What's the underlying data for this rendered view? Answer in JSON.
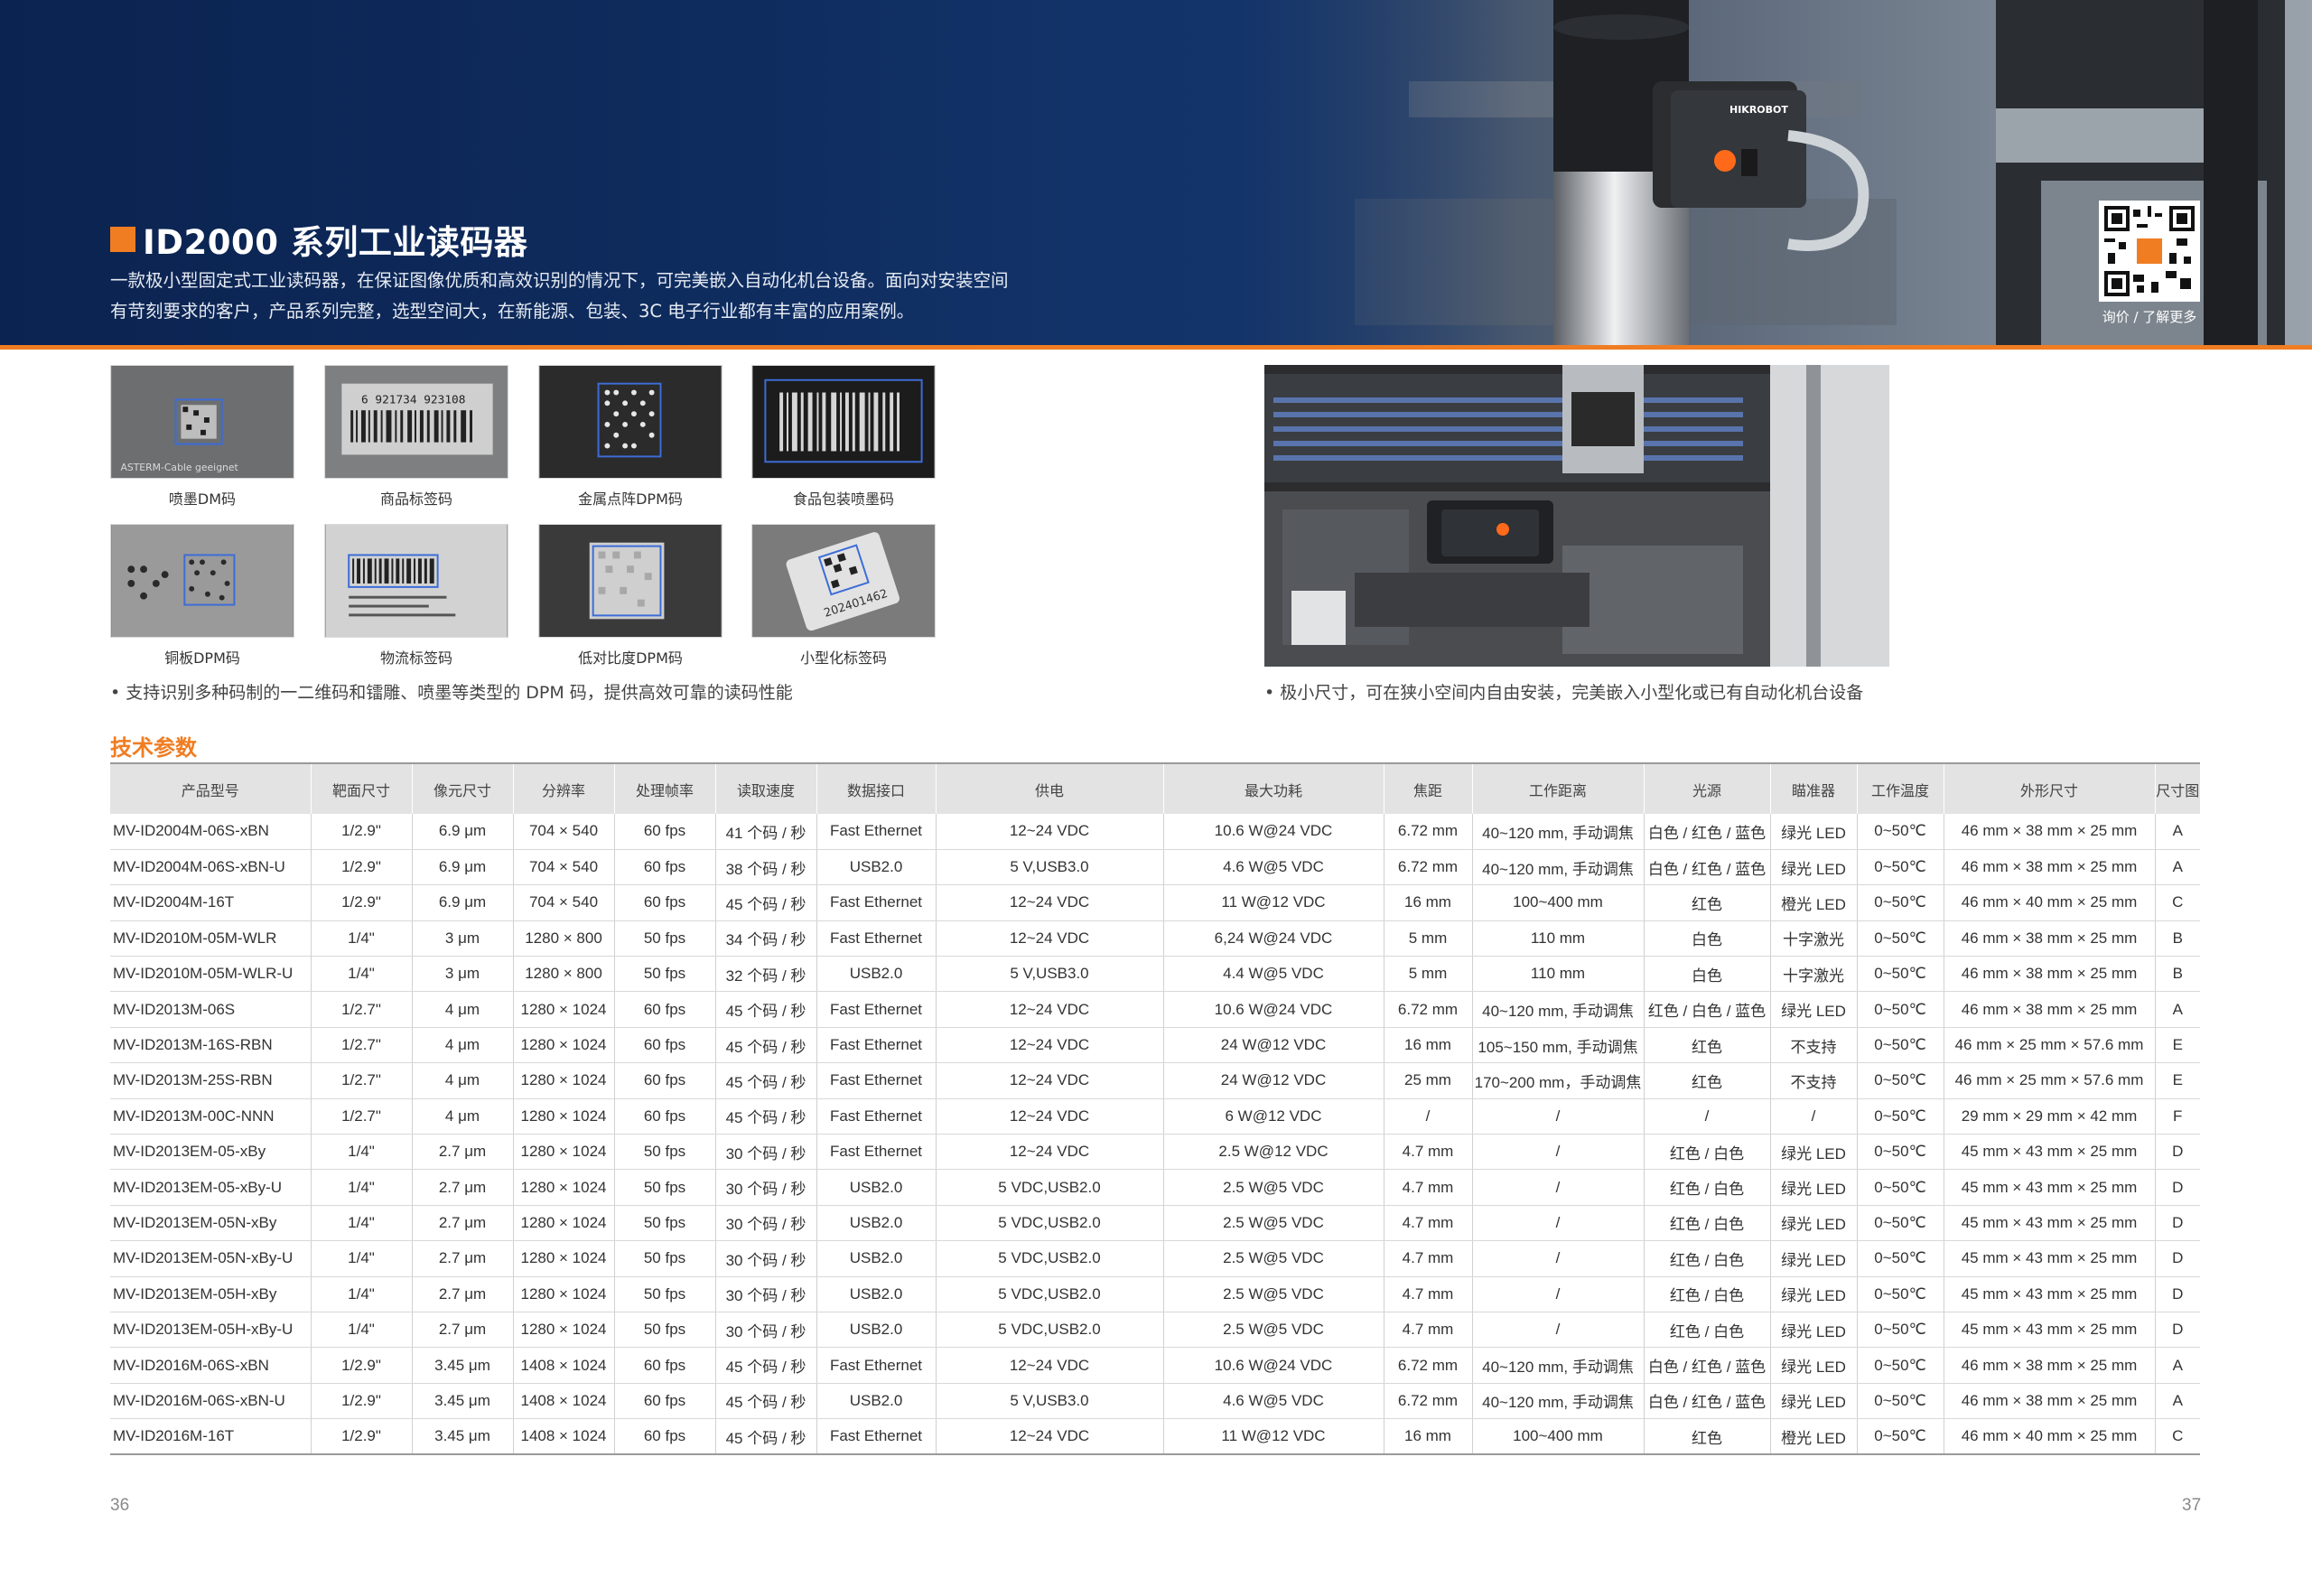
{
  "hero": {
    "title": "ID2000 系列工业读码器",
    "intro_line1": "一款极小型固定式工业读码器，在保证图像优质和高效识别的情况下，可完美嵌入自动化机台设备。面向对安装空间",
    "intro_line2": "有苛刻要求的客户，产品系列完整，选型空间大，在新能源、包装、3C 电子行业都有丰富的应用案例。",
    "qr_caption": "询价 / 了解更多",
    "camera_brand": "HIKROBOT",
    "accent_color": "#f07d22",
    "banner_color": "#0f2d60"
  },
  "samples": [
    {
      "caption": "喷墨DM码"
    },
    {
      "caption": "商品标签码"
    },
    {
      "caption": "金属点阵DPM码"
    },
    {
      "caption": "食品包装喷墨码"
    },
    {
      "caption": "铜板DPM码"
    },
    {
      "caption": "物流标签码"
    },
    {
      "caption": "低对比度DPM码"
    },
    {
      "caption": "小型化标签码"
    }
  ],
  "bullets": {
    "left": "•  支持识别多种码制的一二维码和镭雕、喷墨等类型的 DPM 码，提供高效可靠的读码性能",
    "right": "•  极小尺寸，可在狭小空间内自由安装，完美嵌入小型化或已有自动化机台设备"
  },
  "specs": {
    "section_title": "技术参数",
    "headers": [
      "产品型号",
      "靶面尺寸",
      "像元尺寸",
      "分辨率",
      "处理帧率",
      "读取速度",
      "数据接口",
      "供电",
      "最大功耗",
      "焦距",
      "工作距离",
      "光源",
      "瞄准器",
      "工作温度",
      "外形尺寸",
      "尺寸图"
    ],
    "rows": [
      [
        "MV-ID2004M-06S-xBN",
        "1/2.9\"",
        "6.9 μm",
        "704 × 540",
        "60 fps",
        "41 个码 / 秒",
        "Fast Ethernet",
        "12~24 VDC",
        "10.6 W@24 VDC",
        "6.72 mm",
        "40~120 mm, 手动调焦",
        "白色 / 红色 / 蓝色",
        "绿光 LED",
        "0~50℃",
        "46 mm × 38 mm × 25 mm",
        "A"
      ],
      [
        "MV-ID2004M-06S-xBN-U",
        "1/2.9\"",
        "6.9 μm",
        "704 × 540",
        "60 fps",
        "38 个码 / 秒",
        "USB2.0",
        "5 V,USB3.0",
        "4.6 W@5 VDC",
        "6.72 mm",
        "40~120 mm, 手动调焦",
        "白色 / 红色 / 蓝色",
        "绿光 LED",
        "0~50℃",
        "46 mm × 38 mm × 25 mm",
        "A"
      ],
      [
        "MV-ID2004M-16T",
        "1/2.9\"",
        "6.9 μm",
        "704 × 540",
        "60 fps",
        "45 个码 / 秒",
        "Fast Ethernet",
        "12~24 VDC",
        "11 W@12 VDC",
        "16 mm",
        "100~400 mm",
        "红色",
        "橙光 LED",
        "0~50℃",
        "46 mm × 40 mm × 25 mm",
        "C"
      ],
      [
        "MV-ID2010M-05M-WLR",
        "1/4\"",
        "3 μm",
        "1280 × 800",
        "50 fps",
        "34 个码 / 秒",
        "Fast Ethernet",
        "12~24 VDC",
        "6,24 W@24 VDC",
        "5 mm",
        "110 mm",
        "白色",
        "十字激光",
        "0~50℃",
        "46 mm × 38 mm × 25 mm",
        "B"
      ],
      [
        "MV-ID2010M-05M-WLR-U",
        "1/4\"",
        "3 μm",
        "1280 × 800",
        "50 fps",
        "32 个码 / 秒",
        "USB2.0",
        "5 V,USB3.0",
        "4.4 W@5 VDC",
        "5 mm",
        "110 mm",
        "白色",
        "十字激光",
        "0~50℃",
        "46 mm × 38 mm × 25 mm",
        "B"
      ],
      [
        "MV-ID2013M-06S",
        "1/2.7\"",
        "4 μm",
        "1280 × 1024",
        "60 fps",
        "45 个码 / 秒",
        "Fast Ethernet",
        "12~24 VDC",
        "10.6 W@24 VDC",
        "6.72 mm",
        "40~120 mm, 手动调焦",
        "红色 / 白色 / 蓝色",
        "绿光 LED",
        "0~50℃",
        "46 mm × 38 mm × 25 mm",
        "A"
      ],
      [
        "MV-ID2013M-16S-RBN",
        "1/2.7\"",
        "4 μm",
        "1280 × 1024",
        "60 fps",
        "45 个码 / 秒",
        "Fast Ethernet",
        "12~24 VDC",
        "24 W@12 VDC",
        "16 mm",
        "105~150 mm, 手动调焦",
        "红色",
        "不支持",
        "0~50℃",
        "46 mm × 25 mm × 57.6 mm",
        "E"
      ],
      [
        "MV-ID2013M-25S-RBN",
        "1/2.7\"",
        "4 μm",
        "1280 × 1024",
        "60 fps",
        "45 个码 / 秒",
        "Fast Ethernet",
        "12~24 VDC",
        "24 W@12 VDC",
        "25 mm",
        "170~200 mm，手动调焦",
        "红色",
        "不支持",
        "0~50℃",
        "46 mm × 25 mm × 57.6 mm",
        "E"
      ],
      [
        "MV-ID2013M-00C-NNN",
        "1/2.7\"",
        "4 μm",
        "1280 × 1024",
        "60 fps",
        "45 个码 / 秒",
        "Fast Ethernet",
        "12~24 VDC",
        "6 W@12 VDC",
        "/",
        "/",
        "/",
        "/",
        "0~50℃",
        "29 mm × 29 mm × 42 mm",
        "F"
      ],
      [
        "MV-ID2013EM-05-xBy",
        "1/4\"",
        "2.7 μm",
        "1280 × 1024",
        "50 fps",
        "30 个码 / 秒",
        "Fast Ethernet",
        "12~24 VDC",
        "2.5 W@12 VDC",
        "4.7 mm",
        "/",
        "红色 / 白色",
        "绿光 LED",
        "0~50℃",
        "45 mm × 43 mm × 25 mm",
        "D"
      ],
      [
        "MV-ID2013EM-05-xBy-U",
        "1/4\"",
        "2.7 μm",
        "1280 × 1024",
        "50 fps",
        "30 个码 / 秒",
        "USB2.0",
        "5 VDC,USB2.0",
        "2.5 W@5 VDC",
        "4.7 mm",
        "/",
        "红色 / 白色",
        "绿光 LED",
        "0~50℃",
        "45 mm × 43 mm × 25 mm",
        "D"
      ],
      [
        "MV-ID2013EM-05N-xBy",
        "1/4\"",
        "2.7 μm",
        "1280 × 1024",
        "50 fps",
        "30 个码 / 秒",
        "USB2.0",
        "5 VDC,USB2.0",
        "2.5 W@5 VDC",
        "4.7 mm",
        "/",
        "红色 / 白色",
        "绿光 LED",
        "0~50℃",
        "45 mm × 43 mm × 25 mm",
        "D"
      ],
      [
        "MV-ID2013EM-05N-xBy-U",
        "1/4\"",
        "2.7 μm",
        "1280 × 1024",
        "50 fps",
        "30 个码 / 秒",
        "USB2.0",
        "5 VDC,USB2.0",
        "2.5 W@5 VDC",
        "4.7 mm",
        "/",
        "红色 / 白色",
        "绿光 LED",
        "0~50℃",
        "45 mm × 43 mm × 25 mm",
        "D"
      ],
      [
        "MV-ID2013EM-05H-xBy",
        "1/4\"",
        "2.7 μm",
        "1280 × 1024",
        "50 fps",
        "30 个码 / 秒",
        "USB2.0",
        "5 VDC,USB2.0",
        "2.5 W@5 VDC",
        "4.7 mm",
        "/",
        "红色 / 白色",
        "绿光 LED",
        "0~50℃",
        "45 mm × 43 mm × 25 mm",
        "D"
      ],
      [
        "MV-ID2013EM-05H-xBy-U",
        "1/4\"",
        "2.7 μm",
        "1280 × 1024",
        "50 fps",
        "30 个码 / 秒",
        "USB2.0",
        "5 VDC,USB2.0",
        "2.5 W@5 VDC",
        "4.7 mm",
        "/",
        "红色 / 白色",
        "绿光 LED",
        "0~50℃",
        "45 mm × 43 mm × 25 mm",
        "D"
      ],
      [
        "MV-ID2016M-06S-xBN",
        "1/2.9\"",
        "3.45 μm",
        "1408 × 1024",
        "60 fps",
        "45 个码 / 秒",
        "Fast Ethernet",
        "12~24 VDC",
        "10.6 W@24 VDC",
        "6.72 mm",
        "40~120 mm, 手动调焦",
        "白色 / 红色 / 蓝色",
        "绿光 LED",
        "0~50℃",
        "46 mm × 38 mm × 25 mm",
        "A"
      ],
      [
        "MV-ID2016M-06S-xBN-U",
        "1/2.9\"",
        "3.45 μm",
        "1408 × 1024",
        "60 fps",
        "45 个码 / 秒",
        "USB2.0",
        "5 V,USB3.0",
        "4.6 W@5 VDC",
        "6.72 mm",
        "40~120 mm, 手动调焦",
        "白色 / 红色 / 蓝色",
        "绿光 LED",
        "0~50℃",
        "46 mm × 38 mm × 25 mm",
        "A"
      ],
      [
        "MV-ID2016M-16T",
        "1/2.9\"",
        "3.45 μm",
        "1408 × 1024",
        "60 fps",
        "45 个码 / 秒",
        "Fast Ethernet",
        "12~24 VDC",
        "11 W@12 VDC",
        "16 mm",
        "100~400 mm",
        "红色",
        "橙光 LED",
        "0~50℃",
        "46 mm × 40 mm × 25 mm",
        "C"
      ]
    ]
  },
  "pages": {
    "left": "36",
    "right": "37"
  }
}
